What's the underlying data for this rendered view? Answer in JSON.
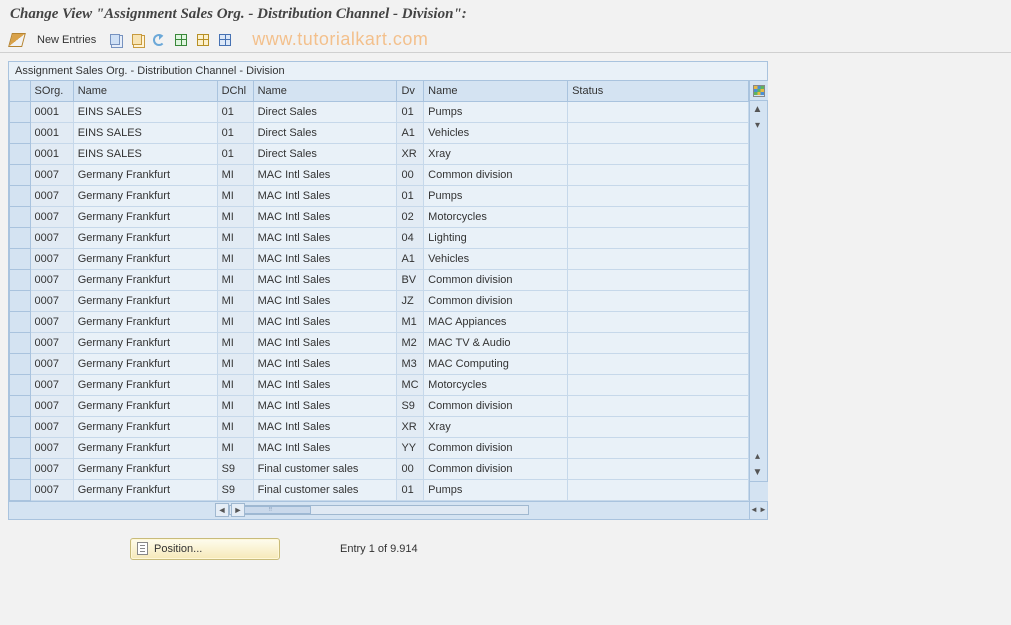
{
  "title": "Change View \"Assignment Sales Org. - Distribution Channel - Division\":",
  "watermark": "www.tutorialkart.com",
  "toolbar": {
    "new_entries": "New Entries"
  },
  "table": {
    "title": "Assignment Sales Org. - Distribution Channel - Division",
    "headers": {
      "sorg": "SOrg.",
      "name1": "Name",
      "dchl": "DChl",
      "name2": "Name",
      "dv": "Dv",
      "name3": "Name",
      "status": "Status"
    },
    "rows": [
      {
        "sorg": "0001",
        "name1": "EINS SALES",
        "dchl": "01",
        "name2": "Direct Sales",
        "dv": "01",
        "name3": "Pumps",
        "status": ""
      },
      {
        "sorg": "0001",
        "name1": "EINS SALES",
        "dchl": "01",
        "name2": "Direct Sales",
        "dv": "A1",
        "name3": "Vehicles",
        "status": ""
      },
      {
        "sorg": "0001",
        "name1": "EINS SALES",
        "dchl": "01",
        "name2": "Direct Sales",
        "dv": "XR",
        "name3": "Xray",
        "status": ""
      },
      {
        "sorg": "0007",
        "name1": "Germany Frankfurt",
        "dchl": "MI",
        "name2": "MAC Intl Sales",
        "dv": "00",
        "name3": "Common division",
        "status": ""
      },
      {
        "sorg": "0007",
        "name1": "Germany Frankfurt",
        "dchl": "MI",
        "name2": "MAC Intl Sales",
        "dv": "01",
        "name3": "Pumps",
        "status": ""
      },
      {
        "sorg": "0007",
        "name1": "Germany Frankfurt",
        "dchl": "MI",
        "name2": "MAC Intl Sales",
        "dv": "02",
        "name3": "Motorcycles",
        "status": ""
      },
      {
        "sorg": "0007",
        "name1": "Germany Frankfurt",
        "dchl": "MI",
        "name2": "MAC Intl Sales",
        "dv": "04",
        "name3": "Lighting",
        "status": ""
      },
      {
        "sorg": "0007",
        "name1": "Germany Frankfurt",
        "dchl": "MI",
        "name2": "MAC Intl Sales",
        "dv": "A1",
        "name3": "Vehicles",
        "status": ""
      },
      {
        "sorg": "0007",
        "name1": "Germany Frankfurt",
        "dchl": "MI",
        "name2": "MAC Intl Sales",
        "dv": "BV",
        "name3": "Common division",
        "status": ""
      },
      {
        "sorg": "0007",
        "name1": "Germany Frankfurt",
        "dchl": "MI",
        "name2": "MAC Intl Sales",
        "dv": "JZ",
        "name3": "Common division",
        "status": ""
      },
      {
        "sorg": "0007",
        "name1": "Germany Frankfurt",
        "dchl": "MI",
        "name2": "MAC Intl Sales",
        "dv": "M1",
        "name3": "MAC Appiances",
        "status": ""
      },
      {
        "sorg": "0007",
        "name1": "Germany Frankfurt",
        "dchl": "MI",
        "name2": "MAC Intl Sales",
        "dv": "M2",
        "name3": "MAC TV & Audio",
        "status": ""
      },
      {
        "sorg": "0007",
        "name1": "Germany Frankfurt",
        "dchl": "MI",
        "name2": "MAC Intl Sales",
        "dv": "M3",
        "name3": "MAC Computing",
        "status": ""
      },
      {
        "sorg": "0007",
        "name1": "Germany Frankfurt",
        "dchl": "MI",
        "name2": "MAC Intl Sales",
        "dv": "MC",
        "name3": "Motorcycles",
        "status": ""
      },
      {
        "sorg": "0007",
        "name1": "Germany Frankfurt",
        "dchl": "MI",
        "name2": "MAC Intl Sales",
        "dv": "S9",
        "name3": "Common division",
        "status": ""
      },
      {
        "sorg": "0007",
        "name1": "Germany Frankfurt",
        "dchl": "MI",
        "name2": "MAC Intl Sales",
        "dv": "XR",
        "name3": "Xray",
        "status": ""
      },
      {
        "sorg": "0007",
        "name1": "Germany Frankfurt",
        "dchl": "MI",
        "name2": "MAC Intl Sales",
        "dv": "YY",
        "name3": "Common division",
        "status": ""
      },
      {
        "sorg": "0007",
        "name1": "Germany Frankfurt",
        "dchl": "S9",
        "name2": "Final customer sales",
        "dv": "00",
        "name3": "Common division",
        "status": ""
      },
      {
        "sorg": "0007",
        "name1": "Germany Frankfurt",
        "dchl": "S9",
        "name2": "Final customer sales",
        "dv": "01",
        "name3": "Pumps",
        "status": ""
      }
    ]
  },
  "footer": {
    "position_label": "Position...",
    "entry_text": "Entry 1 of 9.914"
  }
}
